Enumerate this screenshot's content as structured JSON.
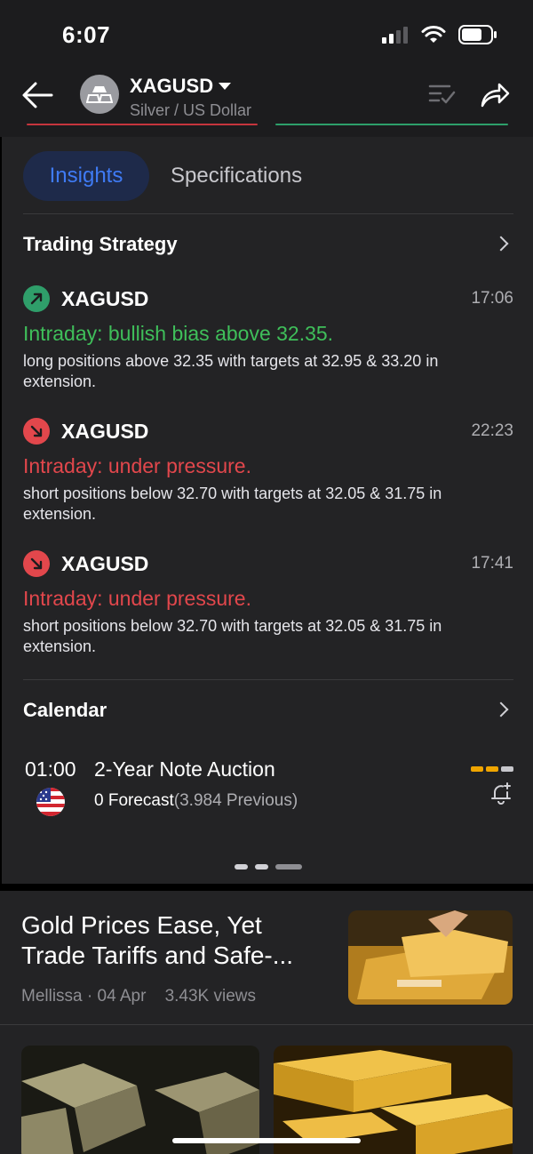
{
  "status_bar": {
    "time": "6:07"
  },
  "header": {
    "symbol": "XAGUSD",
    "subtitle": "Silver / US Dollar"
  },
  "tabs": [
    {
      "label": "Insights",
      "active": true
    },
    {
      "label": "Specifications",
      "active": false
    }
  ],
  "trading_strategy": {
    "title": "Trading Strategy",
    "items": [
      {
        "symbol": "XAGUSD",
        "time": "17:06",
        "direction": "up",
        "title": "Intraday: bullish bias above 32.35.",
        "description": "long positions above 32.35 with targets at 32.95 & 33.20 in extension."
      },
      {
        "symbol": "XAGUSD",
        "time": "22:23",
        "direction": "down",
        "title": "Intraday: under pressure.",
        "description": "short positions below 32.70 with targets at 32.05 & 31.75 in extension."
      },
      {
        "symbol": "XAGUSD",
        "time": "17:41",
        "direction": "down",
        "title": "Intraday: under pressure.",
        "description": "short positions below 32.70 with targets at 32.05 & 31.75 in extension."
      }
    ]
  },
  "calendar": {
    "title": "Calendar",
    "event": {
      "time": "01:00",
      "name": "2-Year Note Auction",
      "forecast": "0 Forecast",
      "previous": "(3.984 Previous)"
    }
  },
  "news": {
    "title": "Gold Prices Ease, Yet Trade Tariffs and Safe-...",
    "author": "Mellissa",
    "date": "04 Apr",
    "views": "3.43K views"
  },
  "colors": {
    "bullish": "#3fbf5a",
    "bearish": "#e2474c",
    "accent": "#3f7bf5",
    "impact_high": "#f0a500",
    "impact_low": "#c7c7cc"
  }
}
